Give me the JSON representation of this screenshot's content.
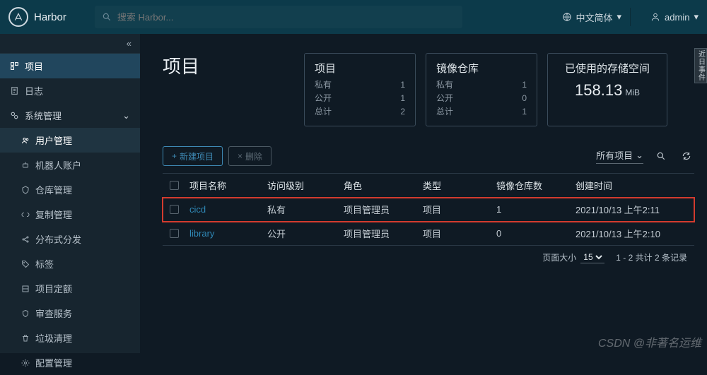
{
  "header": {
    "app_name": "Harbor",
    "search_placeholder": "搜索 Harbor...",
    "lang_label": "中文简体",
    "user_label": "admin"
  },
  "sidebar": {
    "collapse_glyph": "«",
    "items": [
      {
        "id": "projects",
        "label": "项目"
      },
      {
        "id": "logs",
        "label": "日志"
      }
    ],
    "group": {
      "label": "系统管理",
      "children": [
        {
          "id": "users",
          "label": "用户管理",
          "active": true
        },
        {
          "id": "robots",
          "label": "机器人账户"
        },
        {
          "id": "repos",
          "label": "仓库管理"
        },
        {
          "id": "repl",
          "label": "复制管理"
        },
        {
          "id": "dist",
          "label": "分布式分发"
        },
        {
          "id": "labels",
          "label": "标签"
        },
        {
          "id": "quota",
          "label": "项目定额"
        },
        {
          "id": "audit",
          "label": "审查服务"
        },
        {
          "id": "gc",
          "label": "垃圾清理"
        },
        {
          "id": "config",
          "label": "配置管理"
        }
      ]
    }
  },
  "page": {
    "title": "项目"
  },
  "stats": {
    "projects": {
      "title": "项目",
      "private_k": "私有",
      "private_v": "1",
      "public_k": "公开",
      "public_v": "1",
      "total_k": "总计",
      "total_v": "2"
    },
    "repos": {
      "title": "镜像仓库",
      "private_k": "私有",
      "private_v": "1",
      "public_k": "公开",
      "public_v": "0",
      "total_k": "总计",
      "total_v": "1"
    },
    "storage": {
      "title": "已使用的存储空间",
      "value": "158.13",
      "unit": "MiB"
    }
  },
  "toolbar": {
    "new_label": "新建项目",
    "delete_label": "删除",
    "filter_label": "所有项目"
  },
  "table": {
    "columns": {
      "name": "项目名称",
      "access": "访问级别",
      "role": "角色",
      "type": "类型",
      "repos": "镜像仓库数",
      "created": "创建时间"
    },
    "rows": [
      {
        "name": "cicd",
        "access": "私有",
        "role": "项目管理员",
        "type": "项目",
        "repos": "1",
        "created": "2021/10/13 上午2:11",
        "highlight": true
      },
      {
        "name": "library",
        "access": "公开",
        "role": "项目管理员",
        "type": "项目",
        "repos": "0",
        "created": "2021/10/13 上午2:10",
        "highlight": false
      }
    ]
  },
  "pager": {
    "page_size_label": "页面大小",
    "page_size_value": "15",
    "range_text": "1 - 2 共计 2 条记录"
  },
  "side_tab": "近日事件",
  "watermark": "CSDN @非著名运维"
}
